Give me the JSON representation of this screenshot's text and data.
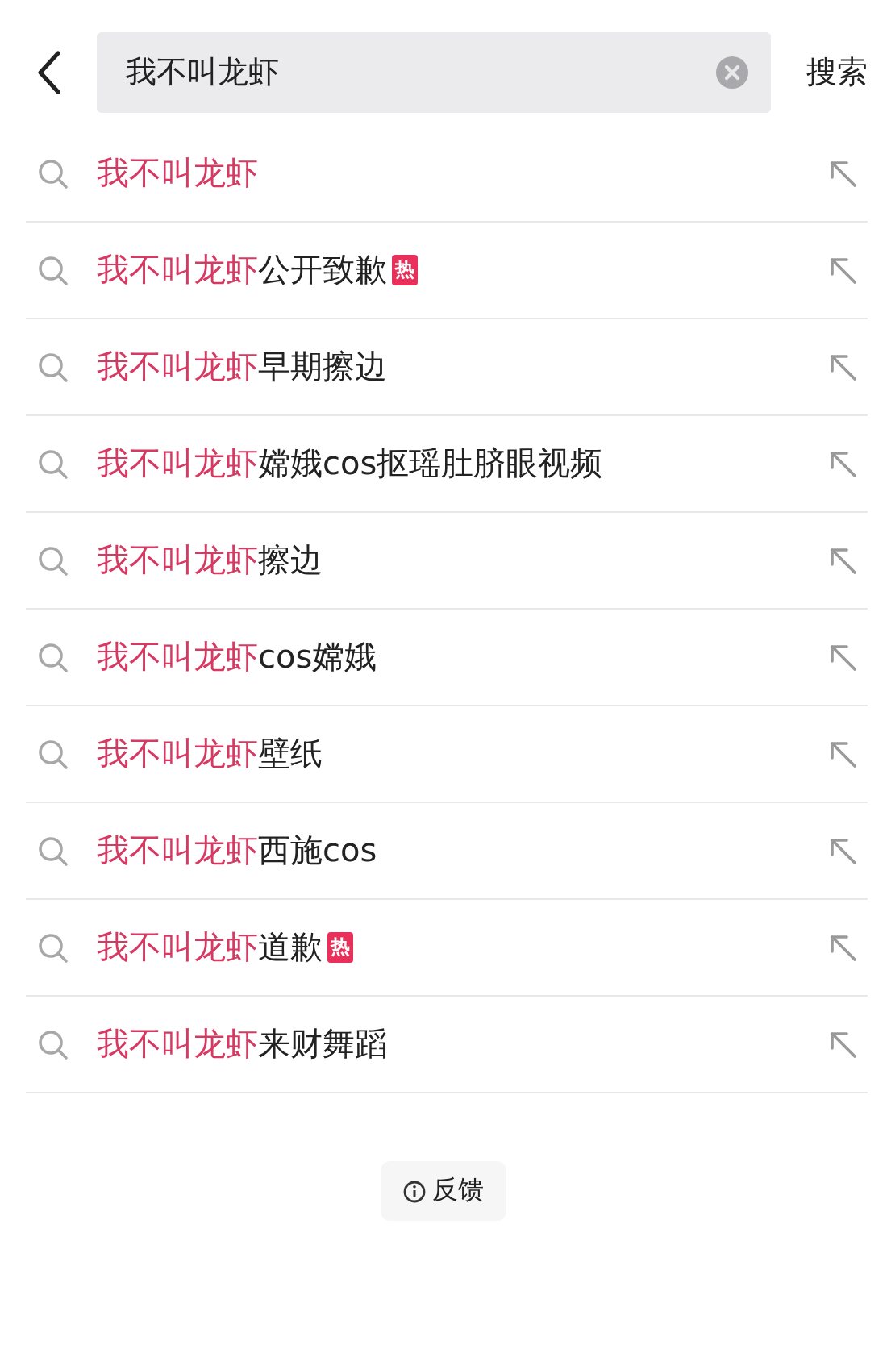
{
  "search": {
    "value": "我不叫龙虾",
    "submit": "搜索"
  },
  "suggestions": [
    {
      "match": "我不叫龙虾"
    },
    {
      "match": "我不叫龙虾",
      "rest": "公开致歉",
      "badge": "热"
    },
    {
      "match": "我不叫龙虾",
      "rest": "早期擦边"
    },
    {
      "match": "我不叫龙虾",
      "rest": "嫦娥cos抠瑶肚脐眼视频"
    },
    {
      "match": "我不叫龙虾",
      "rest": "擦边"
    },
    {
      "match": "我不叫龙虾",
      "rest": "cos嫦娥"
    },
    {
      "match": "我不叫龙虾",
      "rest": "壁纸"
    },
    {
      "match": "我不叫龙虾",
      "rest": "西施cos"
    },
    {
      "match": "我不叫龙虾",
      "rest": "道歉",
      "badge": "热"
    },
    {
      "match": "我不叫龙虾",
      "rest": "来财舞蹈"
    }
  ],
  "feedback": "反馈"
}
